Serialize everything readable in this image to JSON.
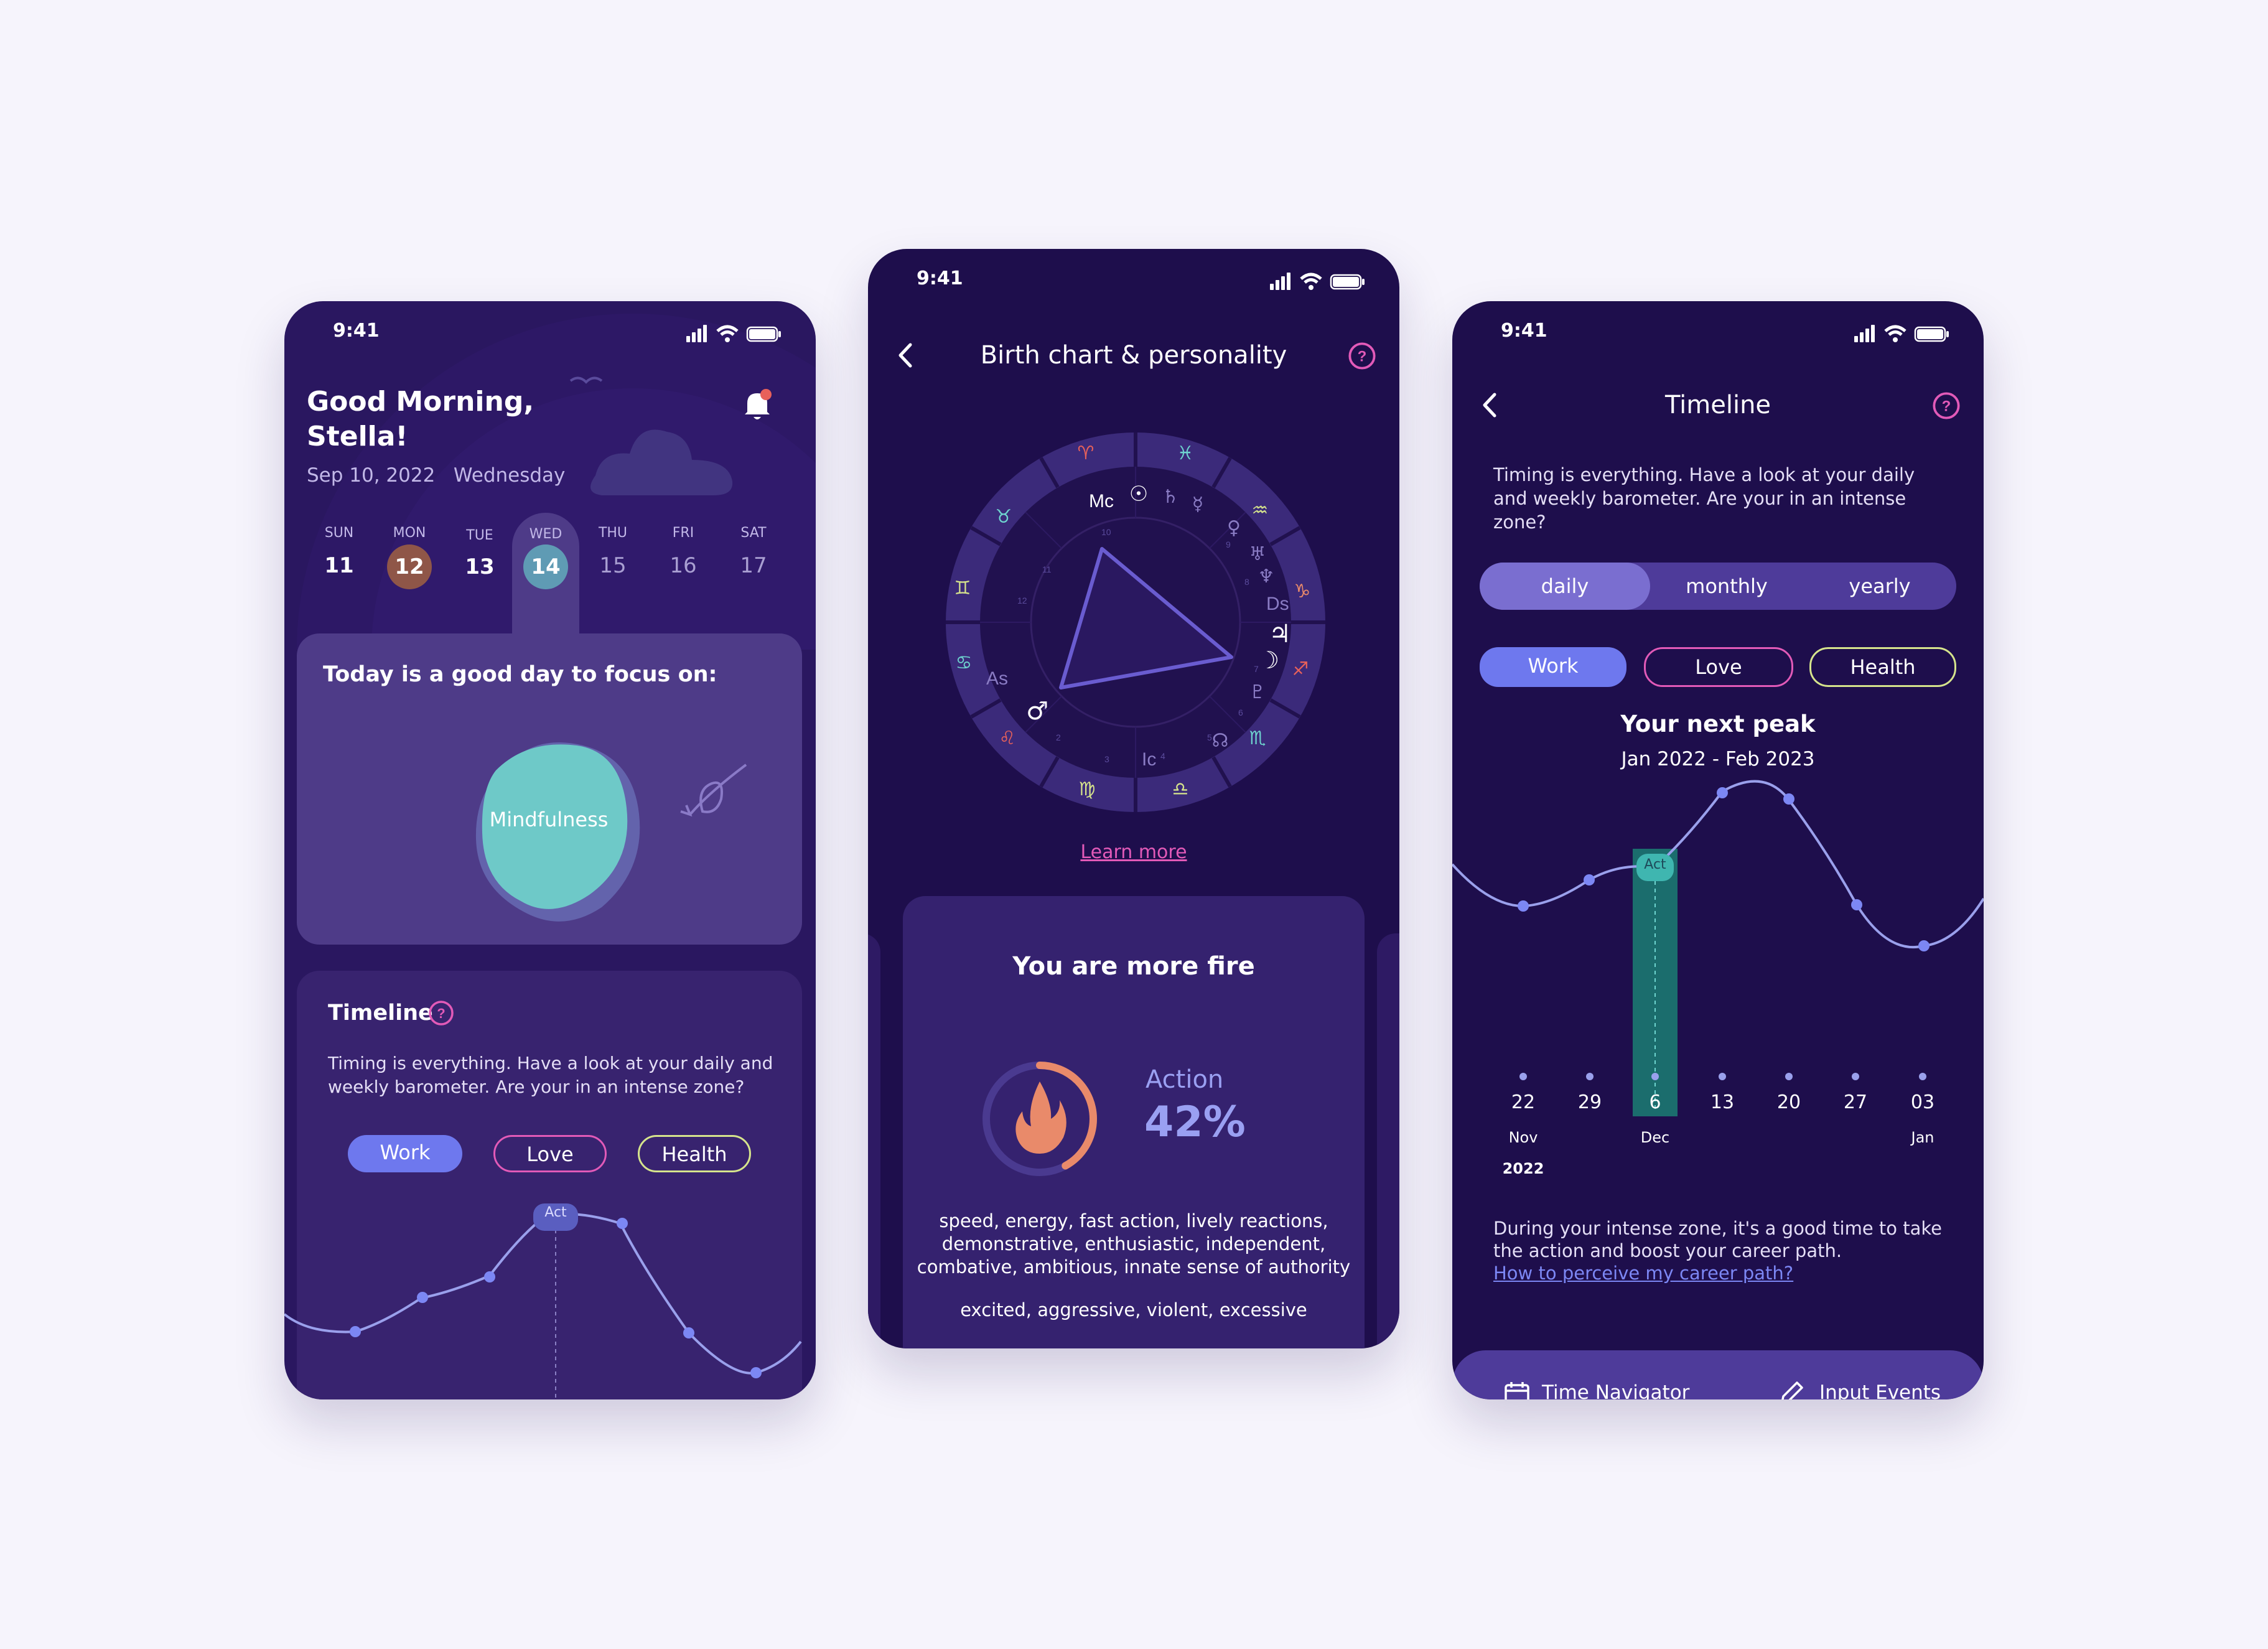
{
  "screen1": {
    "status_time": "9:41",
    "greeting_line1": "Good Morning,",
    "greeting_line2": "Stella!",
    "date": "Sep 10, 2022",
    "weekday": "Wednesday",
    "days": [
      {
        "dow": "SUN",
        "num": "11"
      },
      {
        "dow": "MON",
        "num": "12"
      },
      {
        "dow": "TUE",
        "num": "13"
      },
      {
        "dow": "WED",
        "num": "14"
      },
      {
        "dow": "THU",
        "num": "15"
      },
      {
        "dow": "FRI",
        "num": "16"
      },
      {
        "dow": "SAT",
        "num": "17"
      }
    ],
    "focus_title": "Today is a good day to focus on:",
    "focus_item": "Mindfulness",
    "timeline_title": "Timeline",
    "timeline_text": "Timing is everything. Have a look at your daily and weekly barometer. Are your in an intense zone?",
    "chips": [
      "Work",
      "Love",
      "Health"
    ],
    "act_label": "Act"
  },
  "screen2": {
    "status_time": "9:41",
    "title": "Birth chart & personality",
    "chart_labels": {
      "mc": "Mc",
      "as": "As",
      "ds": "Ds",
      "ic": "Ic"
    },
    "learn_more": "Learn more",
    "card_title": "You are more fire",
    "metric_label": "Action",
    "metric_value": "42%",
    "traits_line1": "speed, energy, fast action, lively reactions,",
    "traits_line2": "demonstrative, enthusiastic, independent,",
    "traits_line3": "combative, ambitious, innate sense of authority",
    "negatives": "excited, aggressive, violent, excessive"
  },
  "screen3": {
    "status_time": "9:41",
    "title": "Timeline",
    "intro": "Timing is everything. Have a look at your daily and weekly barometer. Are your in an intense zone?",
    "periods": [
      "daily",
      "monthly",
      "yearly"
    ],
    "chips": [
      "Work",
      "Love",
      "Health"
    ],
    "peak_title": "Your next peak",
    "peak_range": "Jan 2022 - Feb 2023",
    "act_label": "Act",
    "dates": [
      "22",
      "29",
      "6",
      "13",
      "20",
      "27",
      "03"
    ],
    "months": {
      "nov": "Nov",
      "dec": "Dec",
      "jan": "Jan"
    },
    "year": "2022",
    "footer_text_line1": "During your intense zone, it's a good time to take",
    "footer_text_line2": "the action and  boost your career path.",
    "link": "How to perceive my career path?",
    "nav": [
      "Time Navigator",
      "Input Events"
    ]
  },
  "colors": {
    "work": "#7b83f0",
    "love": "#e05fb4",
    "health": "#d6e48c",
    "teal": "#6ed4cf",
    "fire": "#e98a6a",
    "accent": "#e25ab8"
  }
}
